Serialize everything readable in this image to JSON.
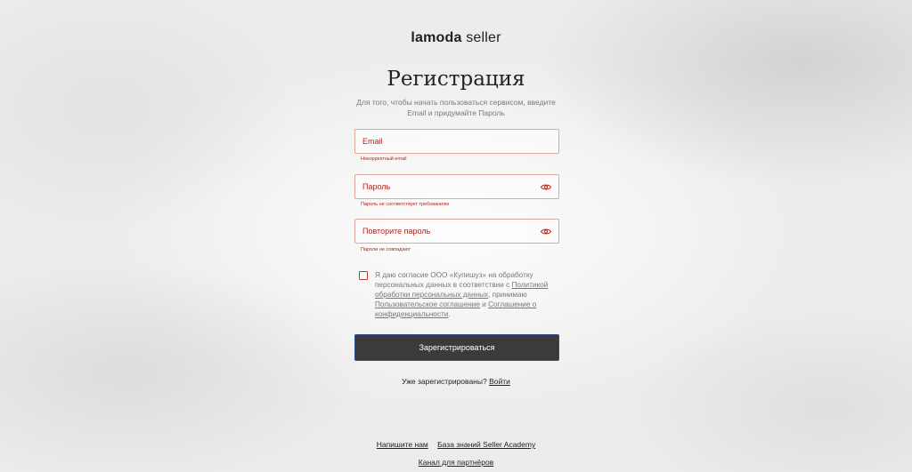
{
  "logo": {
    "brand": "lamoda",
    "suffix": " seller"
  },
  "title": "Регистрация",
  "subtitle": "Для того, чтобы начать пользоваться сервисом, введите Email и придумайте Пароль",
  "fields": {
    "email": {
      "placeholder": "Email",
      "error": "Некорректный email"
    },
    "password": {
      "placeholder": "Пароль",
      "error": "Пароль не соответствует требованиям",
      "icon": "eye-icon"
    },
    "repeat": {
      "placeholder": "Повторите пароль",
      "error": "Пароли не совпадают",
      "icon": "eye-icon"
    }
  },
  "consent": {
    "text1": "Я даю согласие ООО «Купишуз» на обработку персональных данных в соответствии с ",
    "link1": "Политикой обработки персональных данных",
    "text2": ", принимаю ",
    "link2": "Пользовательское соглашение",
    "text3": " и ",
    "link3": "Соглашение о конфиденциальности",
    "text4": "."
  },
  "submit_label": "Зарегистрироваться",
  "login": {
    "question": "Уже зарегистрированы? ",
    "link": "Войти"
  },
  "footer": {
    "write_us": "Напишите нам",
    "knowledge_base": "База знаний Seller Academy",
    "partner_channel": "Канал для партнёров"
  },
  "colors": {
    "error": "#b3261e",
    "button": "#3b3b3b",
    "border_error": "#e2a8a0"
  }
}
